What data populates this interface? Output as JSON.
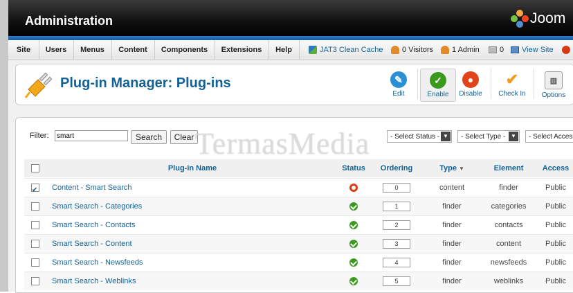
{
  "header": {
    "title": "Administration",
    "logo_text": "Joom"
  },
  "menu": [
    "Site",
    "Users",
    "Menus",
    "Content",
    "Components",
    "Extensions",
    "Help"
  ],
  "status": {
    "cache": "JAT3 Clean Cache",
    "visitors": "0 Visitors",
    "admins": "1 Admin",
    "messages": "0",
    "view_site": "View Site"
  },
  "toolbar": {
    "page_title": "Plug-in Manager: Plug-ins",
    "buttons": [
      {
        "label": "Edit",
        "icon": "pencil-icon",
        "color": "#2b8fd8"
      },
      {
        "label": "Enable",
        "icon": "check-icon",
        "color": "#3a9a1e"
      },
      {
        "label": "Disable",
        "icon": "circle-off-icon",
        "color": "#e0441a"
      },
      {
        "label": "Check In",
        "icon": "checkmark-icon",
        "color": "#f39a1c"
      },
      {
        "label": "Options",
        "icon": "options-icon",
        "color": "#888888"
      }
    ]
  },
  "filter": {
    "label": "Filter:",
    "value": "smart",
    "search_label": "Search",
    "clear_label": "Clear",
    "status_select": "- Select Status -",
    "type_select": "- Select Type -",
    "access_select": "- Select Access -"
  },
  "table": {
    "columns": [
      "Plug-in Name",
      "Status",
      "Ordering",
      "Type",
      "Element",
      "Access"
    ],
    "rows": [
      {
        "checked": true,
        "name": "Content - Smart Search",
        "status": "disabled",
        "ordering": "0",
        "type": "content",
        "element": "finder",
        "access": "Public"
      },
      {
        "checked": false,
        "name": "Smart Search - Categories",
        "status": "enabled",
        "ordering": "1",
        "type": "finder",
        "element": "categories",
        "access": "Public"
      },
      {
        "checked": false,
        "name": "Smart Search - Contacts",
        "status": "enabled",
        "ordering": "2",
        "type": "finder",
        "element": "contacts",
        "access": "Public"
      },
      {
        "checked": false,
        "name": "Smart Search - Content",
        "status": "enabled",
        "ordering": "3",
        "type": "finder",
        "element": "content",
        "access": "Public"
      },
      {
        "checked": false,
        "name": "Smart Search - Newsfeeds",
        "status": "enabled",
        "ordering": "4",
        "type": "finder",
        "element": "newsfeeds",
        "access": "Public"
      },
      {
        "checked": false,
        "name": "Smart Search - Weblinks",
        "status": "enabled",
        "ordering": "5",
        "type": "finder",
        "element": "weblinks",
        "access": "Public"
      }
    ]
  },
  "watermark": "TermasMedia"
}
